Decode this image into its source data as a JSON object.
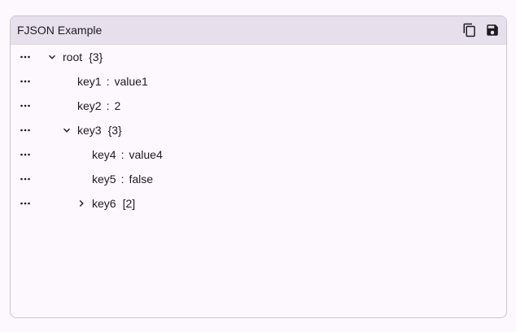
{
  "header": {
    "title": "FJSON Example",
    "copy_icon": "copy-icon",
    "save_icon": "save-icon"
  },
  "tree": [
    {
      "key": "root",
      "meta": "{3}",
      "depth": 0,
      "kind": "object",
      "expanded": true
    },
    {
      "key": "key1",
      "value": "value1",
      "depth": 1,
      "kind": "leaf"
    },
    {
      "key": "key2",
      "value": "2",
      "depth": 1,
      "kind": "leaf"
    },
    {
      "key": "key3",
      "meta": "{3}",
      "depth": 1,
      "kind": "object",
      "expanded": true
    },
    {
      "key": "key4",
      "value": "value4",
      "depth": 2,
      "kind": "leaf"
    },
    {
      "key": "key5",
      "value": "false",
      "depth": 2,
      "kind": "leaf"
    },
    {
      "key": "key6",
      "meta": "[2]",
      "depth": 2,
      "kind": "array",
      "expanded": false
    }
  ],
  "separator": ":",
  "colors": {
    "header_bg": "#e7e0ec",
    "border": "#c9c5ca",
    "background": "#fdf8fd",
    "text": "#1d1b20"
  }
}
